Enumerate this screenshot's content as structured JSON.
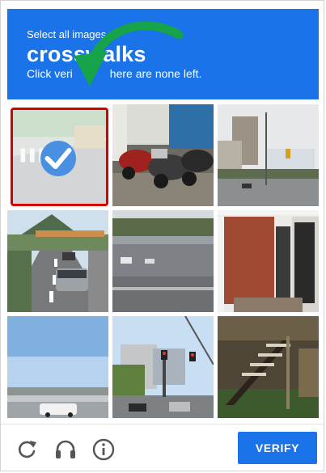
{
  "header": {
    "instruction": "Select all images w",
    "target": "crossw",
    "target_tail": "alks",
    "subtext_start": "Click veri",
    "subtext_end": "here are none left."
  },
  "grid": {
    "tiles": [
      {
        "selected": true
      },
      {
        "selected": false
      },
      {
        "selected": false
      },
      {
        "selected": false
      },
      {
        "selected": false
      },
      {
        "selected": false
      },
      {
        "selected": false
      },
      {
        "selected": false
      },
      {
        "selected": false
      }
    ]
  },
  "footer": {
    "reload_icon": "reload-icon",
    "audio_icon": "headphones-icon",
    "info_icon": "info-icon",
    "verify_label": "VERIFY"
  },
  "colors": {
    "accent": "#1a73e8",
    "selected_border": "#d50000",
    "check": "#4a90e2",
    "arrow": "#16a34a"
  }
}
